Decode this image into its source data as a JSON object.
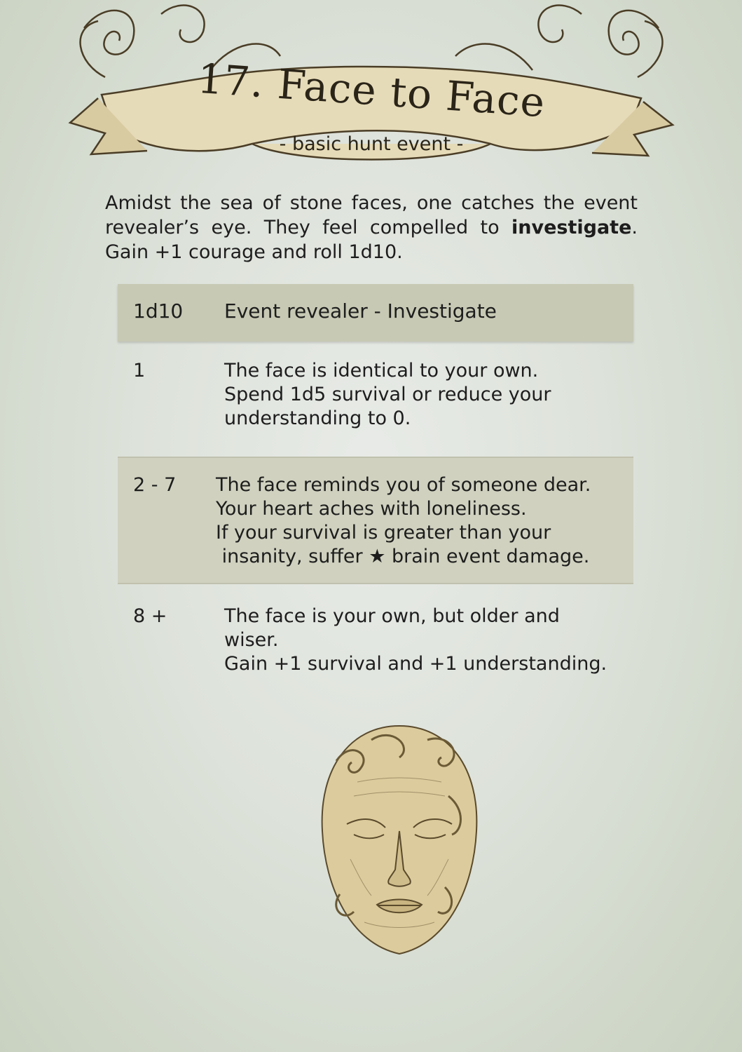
{
  "header": {
    "title": "17. Face to Face",
    "subtitle": "- basic hunt event -"
  },
  "intro": {
    "part1": "Amidst the sea of stone faces, one catches the event revealer’s eye. They feel compelled to ",
    "emphasis": "investigate",
    "part2": ". Gain +1 courage and roll 1d10."
  },
  "table": {
    "header": {
      "roll": "1d10",
      "result": "Event revealer - Investigate"
    },
    "rows": [
      {
        "roll": "1",
        "lines": [
          "The face is identical to your own.",
          "Spend 1d5 survival or reduce your",
          "understanding to 0."
        ]
      },
      {
        "roll": "2 - 7",
        "lines": [
          "The face reminds you of someone dear.",
          "Your heart aches with loneliness.",
          "If your survival is greater than your",
          " insanity, suffer ★ brain event damage."
        ]
      },
      {
        "roll": "8 +",
        "lines": [
          "The face is your own, but older and",
          "wiser.",
          "Gain +1 survival and +1 understanding."
        ]
      }
    ]
  },
  "colors": {
    "background": "#dde2da",
    "header_row": "#c7c9b4",
    "banner": "#e4d8b4",
    "stone_face": "#d9c99a"
  }
}
